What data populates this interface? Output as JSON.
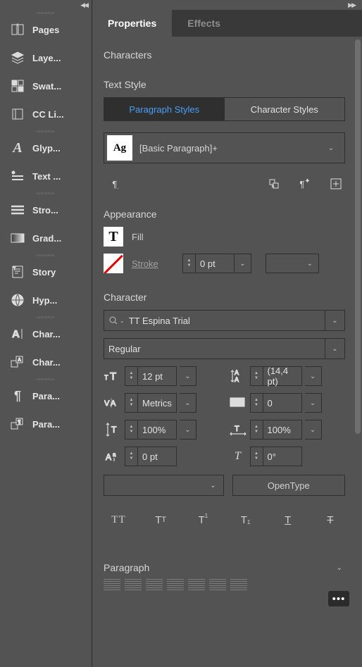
{
  "sidebar": {
    "groups": [
      [
        {
          "icon": "pages",
          "label": "Pages"
        },
        {
          "icon": "layers",
          "label": "Laye..."
        },
        {
          "icon": "swatches",
          "label": "Swat..."
        },
        {
          "icon": "cclib",
          "label": "CC Li..."
        }
      ],
      [
        {
          "icon": "glyphs",
          "label": "Glyp..."
        },
        {
          "icon": "text",
          "label": "Text ..."
        }
      ],
      [
        {
          "icon": "stroke",
          "label": "Stro..."
        },
        {
          "icon": "gradient",
          "label": "Grad..."
        }
      ],
      [
        {
          "icon": "story",
          "label": "Story"
        },
        {
          "icon": "hyperlinks",
          "label": "Hyp..."
        }
      ],
      [
        {
          "icon": "char",
          "label": "Char..."
        },
        {
          "icon": "charstyles",
          "label": "Char..."
        }
      ],
      [
        {
          "icon": "para",
          "label": "Para..."
        },
        {
          "icon": "parastyles",
          "label": "Para..."
        }
      ]
    ]
  },
  "tabs": {
    "properties": "Properties",
    "effects": "Effects"
  },
  "characters_heading": "Characters",
  "text_style": {
    "heading": "Text Style",
    "paragraph_styles": "Paragraph Styles",
    "character_styles": "Character Styles",
    "swatch": "Ag",
    "style_name": "[Basic Paragraph]+"
  },
  "appearance": {
    "heading": "Appearance",
    "fill": "Fill",
    "stroke": "Stroke ",
    "stroke_weight": "0 pt"
  },
  "character": {
    "heading": "Character",
    "font_family": "TT Espina Trial",
    "font_style": "Regular",
    "size": "12 pt",
    "leading": "(14,4 pt)",
    "kerning": "Metrics",
    "tracking": "0",
    "vscale": "100%",
    "hscale": "100%",
    "baseline": "0 pt",
    "skew": "0°",
    "opentype": "OpenType"
  },
  "paragraph_heading": "Paragraph"
}
